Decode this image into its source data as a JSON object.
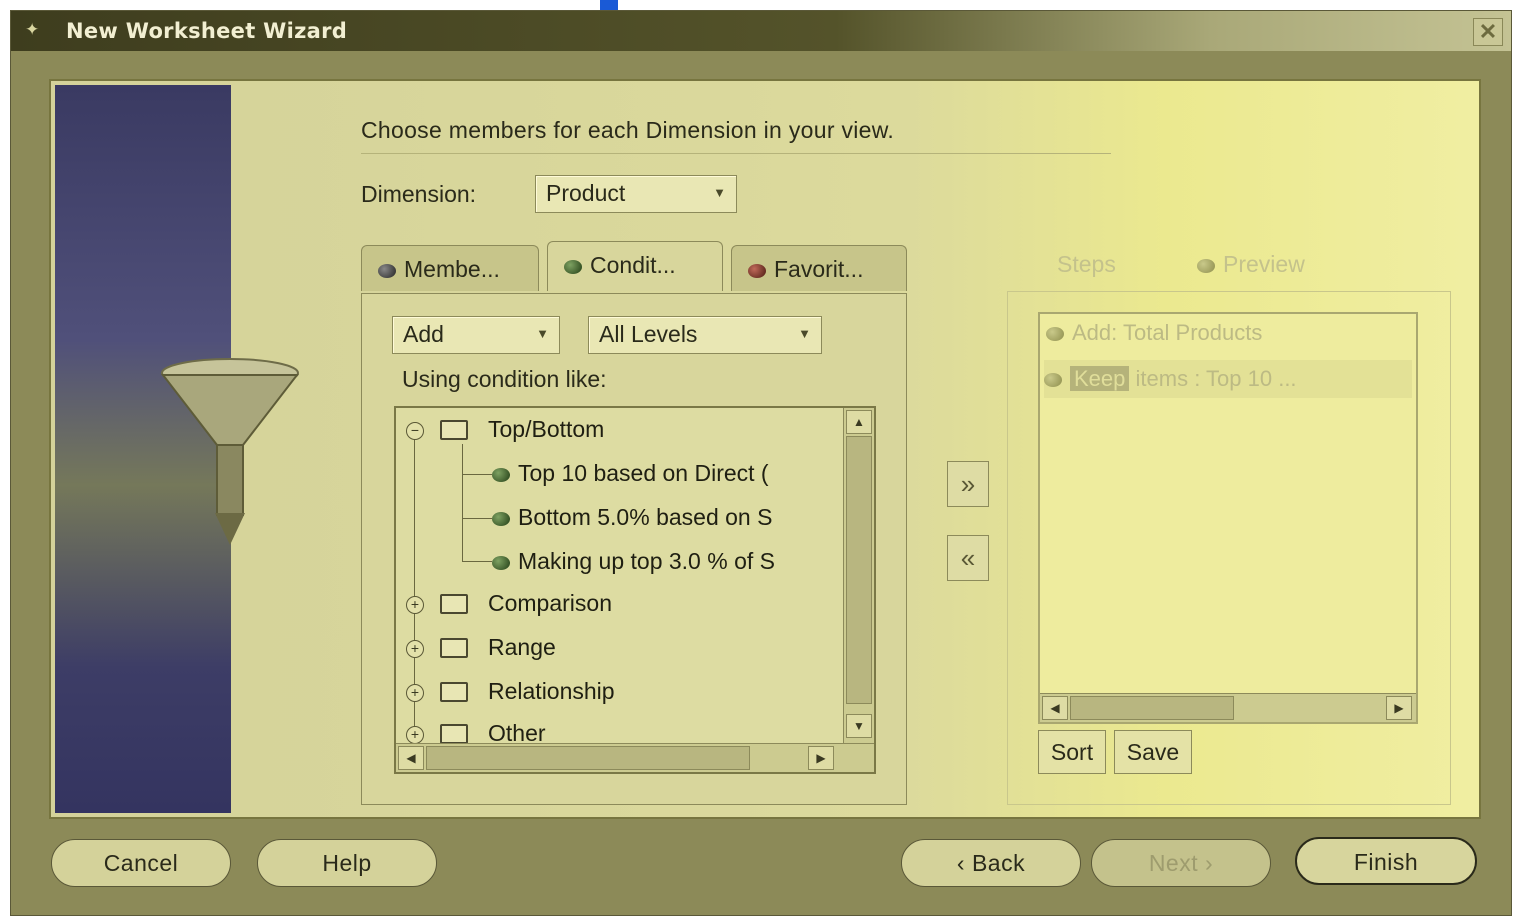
{
  "window": {
    "title": "New Worksheet Wizard"
  },
  "prompt": "Choose members for each Dimension in your view.",
  "dimension": {
    "label": "Dimension:",
    "value": "Product"
  },
  "tabs": [
    {
      "label": "Membe...",
      "icon": "dark-dot-icon"
    },
    {
      "label": "Condit...",
      "icon": "green-dot-icon",
      "active": true
    },
    {
      "label": "Favorit...",
      "icon": "red-dot-icon"
    }
  ],
  "condition_panel": {
    "action_value": "Add",
    "levels_value": "All Levels",
    "using_label": "Using condition like:",
    "tree": {
      "group": "Top/Bottom",
      "children": [
        "Top 10 based on Direct (",
        "Bottom 5.0% based on S",
        "Making up top 3.0 % of S"
      ],
      "collapsed": [
        "Comparison",
        "Range",
        "Relationship",
        "Other"
      ]
    }
  },
  "move_buttons": {
    "add": "»",
    "remove": "«"
  },
  "right_tabs": {
    "steps": "Steps",
    "preview": "Preview"
  },
  "steps": {
    "items": [
      "Add: Total Products"
    ],
    "selected": {
      "highlight": "Keep",
      "rest": "items : Top 10",
      "more": "..."
    }
  },
  "steps_buttons": {
    "sort": "Sort",
    "save": "Save"
  },
  "footer": {
    "cancel": "Cancel",
    "help": "Help",
    "back": "Back",
    "next": "Next",
    "finish": "Finish"
  },
  "colors": {
    "window": "#8c8a58",
    "content": "#d8d69c",
    "titlebar": "#3e3d1e",
    "sidebar": "#3a3a62"
  }
}
